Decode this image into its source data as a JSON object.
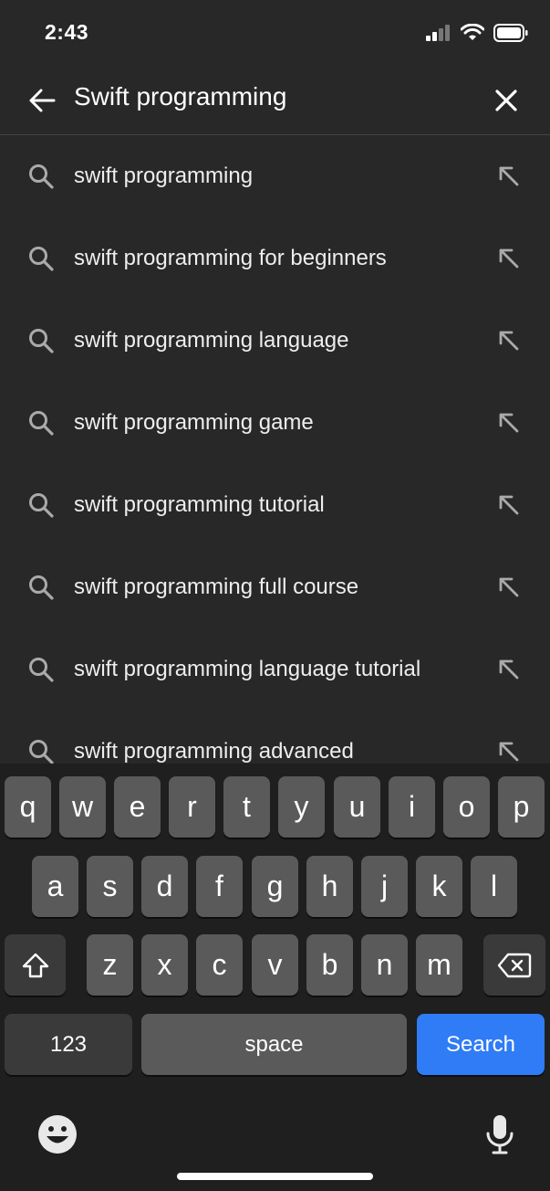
{
  "status": {
    "time": "2:43",
    "icons": [
      "signal-icon",
      "wifi-icon",
      "battery-icon"
    ]
  },
  "search": {
    "query": "Swift programming",
    "back_icon": "back-arrow-icon",
    "clear_icon": "close-icon"
  },
  "suggestions": [
    {
      "label": "swift programming"
    },
    {
      "label": "swift programming for beginners"
    },
    {
      "label": "swift programming language"
    },
    {
      "label": "swift programming game"
    },
    {
      "label": "swift programming tutorial"
    },
    {
      "label": "swift programming full course"
    },
    {
      "label": "swift programming language tutorial"
    },
    {
      "label": "swift programming advanced"
    }
  ],
  "keyboard": {
    "row1": [
      "q",
      "w",
      "e",
      "r",
      "t",
      "y",
      "u",
      "i",
      "o",
      "p"
    ],
    "row2": [
      "a",
      "s",
      "d",
      "f",
      "g",
      "h",
      "j",
      "k",
      "l"
    ],
    "row3": [
      "z",
      "x",
      "c",
      "v",
      "b",
      "n",
      "m"
    ],
    "numbers_label": "123",
    "space_label": "space",
    "search_label": "Search",
    "colors": {
      "key": "#5a5a5a",
      "dark_key": "#3a3a3a",
      "search_key": "#2f7cf6"
    }
  }
}
